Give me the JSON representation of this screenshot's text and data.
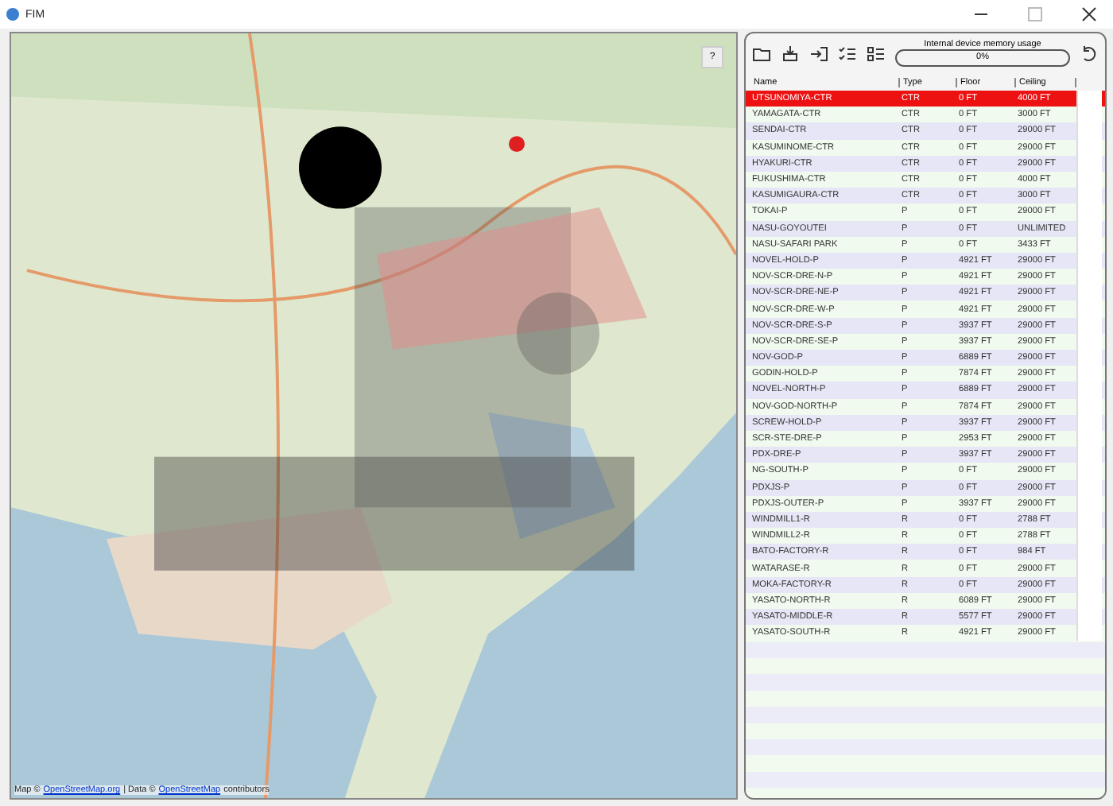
{
  "window": {
    "title": "FIM"
  },
  "map": {
    "help_button": "?",
    "attribution": {
      "prefix": "Map ©",
      "link1": "OpenStreetMap.org",
      "separator": "| Data ©",
      "link2": "OpenStreetMap",
      "suffix": "contributors"
    }
  },
  "memory": {
    "label": "Internal device memory usage",
    "reading": "0%"
  },
  "table": {
    "columns": [
      "Name",
      "Type",
      "Floor",
      "Ceiling"
    ],
    "rows": [
      {
        "cells": [
          "UTSUNOMIYA-CTR",
          "CTR",
          "0 FT",
          "4000 FT"
        ],
        "selected": true
      },
      {
        "cells": [
          "YAMAGATA-CTR",
          "CTR",
          "0 FT",
          "3000 FT"
        ],
        "selected": false
      },
      {
        "cells": [
          "SENDAI-CTR",
          "CTR",
          "0 FT",
          "29000 FT"
        ],
        "selected": false
      },
      {
        "cells": [
          "KASUMINOME-CTR",
          "CTR",
          "0 FT",
          "29000 FT"
        ],
        "selected": false
      },
      {
        "cells": [
          "HYAKURI-CTR",
          "CTR",
          "0 FT",
          "29000 FT"
        ],
        "selected": false
      },
      {
        "cells": [
          "FUKUSHIMA-CTR",
          "CTR",
          "0 FT",
          "4000 FT"
        ],
        "selected": false
      },
      {
        "cells": [
          "KASUMIGAURA-CTR",
          "CTR",
          "0 FT",
          "3000 FT"
        ],
        "selected": false
      },
      {
        "cells": [
          "TOKAI-P",
          "P",
          "0 FT",
          "29000 FT"
        ],
        "selected": false
      },
      {
        "cells": [
          "NASU-GOYOUTEI",
          "P",
          "0 FT",
          "UNLIMITED"
        ],
        "selected": false
      },
      {
        "cells": [
          "NASU-SAFARI PARK",
          "P",
          "0 FT",
          "3433 FT"
        ],
        "selected": false
      },
      {
        "cells": [
          "NOVEL-HOLD-P",
          "P",
          "4921 FT",
          "29000 FT"
        ],
        "selected": false
      },
      {
        "cells": [
          "NOV-SCR-DRE-N-P",
          "P",
          "4921 FT",
          "29000 FT"
        ],
        "selected": false
      },
      {
        "cells": [
          "NOV-SCR-DRE-NE-P",
          "P",
          "4921 FT",
          "29000 FT"
        ],
        "selected": false
      },
      {
        "cells": [
          "NOV-SCR-DRE-W-P",
          "P",
          "4921 FT",
          "29000 FT"
        ],
        "selected": false
      },
      {
        "cells": [
          "NOV-SCR-DRE-S-P",
          "P",
          "3937 FT",
          "29000 FT"
        ],
        "selected": false
      },
      {
        "cells": [
          "NOV-SCR-DRE-SE-P",
          "P",
          "3937 FT",
          "29000 FT"
        ],
        "selected": false
      },
      {
        "cells": [
          "NOV-GOD-P",
          "P",
          "6889 FT",
          "29000 FT"
        ],
        "selected": false
      },
      {
        "cells": [
          "GODIN-HOLD-P",
          "P",
          "7874 FT",
          "29000 FT"
        ],
        "selected": false
      },
      {
        "cells": [
          "NOVEL-NORTH-P",
          "P",
          "6889 FT",
          "29000 FT"
        ],
        "selected": false
      },
      {
        "cells": [
          "NOV-GOD-NORTH-P",
          "P",
          "7874 FT",
          "29000 FT"
        ],
        "selected": false
      },
      {
        "cells": [
          "SCREW-HOLD-P",
          "P",
          "3937 FT",
          "29000 FT"
        ],
        "selected": false
      },
      {
        "cells": [
          "SCR-STE-DRE-P",
          "P",
          "2953 FT",
          "29000 FT"
        ],
        "selected": false
      },
      {
        "cells": [
          "PDX-DRE-P",
          "P",
          "3937 FT",
          "29000 FT"
        ],
        "selected": false
      },
      {
        "cells": [
          "NG-SOUTH-P",
          "P",
          "0 FT",
          "29000 FT"
        ],
        "selected": false
      },
      {
        "cells": [
          "PDXJS-P",
          "P",
          "0 FT",
          "29000 FT"
        ],
        "selected": false
      },
      {
        "cells": [
          "PDXJS-OUTER-P",
          "P",
          "3937 FT",
          "29000 FT"
        ],
        "selected": false
      },
      {
        "cells": [
          "WINDMILL1-R",
          "R",
          "0 FT",
          "2788 FT"
        ],
        "selected": false
      },
      {
        "cells": [
          "WINDMILL2-R",
          "R",
          "0 FT",
          "2788 FT"
        ],
        "selected": false
      },
      {
        "cells": [
          "BATO-FACTORY-R",
          "R",
          "0 FT",
          "984 FT"
        ],
        "selected": false
      },
      {
        "cells": [
          "WATARASE-R",
          "R",
          "0 FT",
          "29000 FT"
        ],
        "selected": false
      },
      {
        "cells": [
          "MOKA-FACTORY-R",
          "R",
          "0 FT",
          "29000 FT"
        ],
        "selected": false
      },
      {
        "cells": [
          "YASATO-NORTH-R",
          "R",
          "6089 FT",
          "29000 FT"
        ],
        "selected": false
      },
      {
        "cells": [
          "YASATO-MIDDLE-R",
          "R",
          "5577 FT",
          "29000 FT"
        ],
        "selected": false
      },
      {
        "cells": [
          "YASATO-SOUTH-R",
          "R",
          "4921 FT",
          "29000 FT"
        ],
        "selected": false
      }
    ]
  }
}
